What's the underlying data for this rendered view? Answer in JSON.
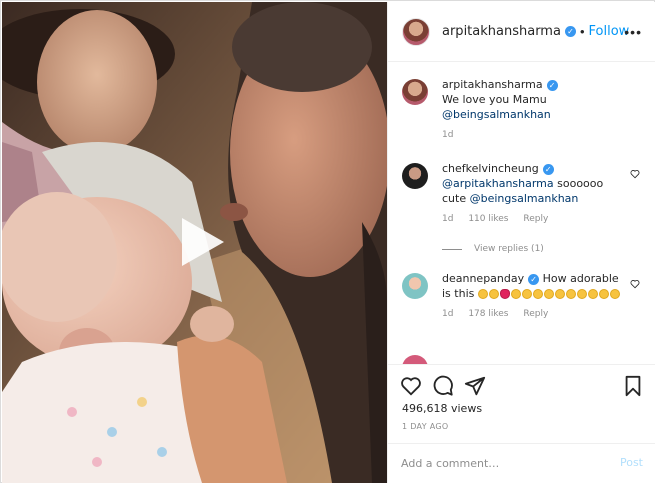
{
  "header": {
    "username": "arpitakhansharma",
    "separator": "•",
    "follow_label": "Follow",
    "more_label": "•••"
  },
  "comments": [
    {
      "username": "arpitakhansharma",
      "text": "We love you Mamu",
      "mention": "@beingsalmankhan",
      "time": "1d"
    },
    {
      "username": "chefkelvincheung",
      "mention": "@arpitakhansharma",
      "text": "soooooo cute",
      "mention2": "@beingsalmankhan",
      "time": "1d",
      "likes": "110 likes",
      "reply_label": "Reply",
      "view_replies": "View replies (1)"
    },
    {
      "username": "deannepanday",
      "text": "How adorable is this",
      "time": "1d",
      "likes": "178 likes",
      "reply_label": "Reply"
    }
  ],
  "stats": {
    "views": "496,618 views",
    "posted": "1 DAY AGO"
  },
  "add_comment": {
    "placeholder": "Add a comment…",
    "post_label": "Post"
  },
  "colors": {
    "accent": "#0095f6",
    "verified": "#3897f0",
    "muted": "#8e8e8e",
    "border": "#dbdbdb"
  },
  "icons": [
    "play-icon",
    "verified-badge-icon",
    "heart-icon",
    "comment-icon",
    "share-icon",
    "bookmark-icon",
    "more-icon"
  ]
}
